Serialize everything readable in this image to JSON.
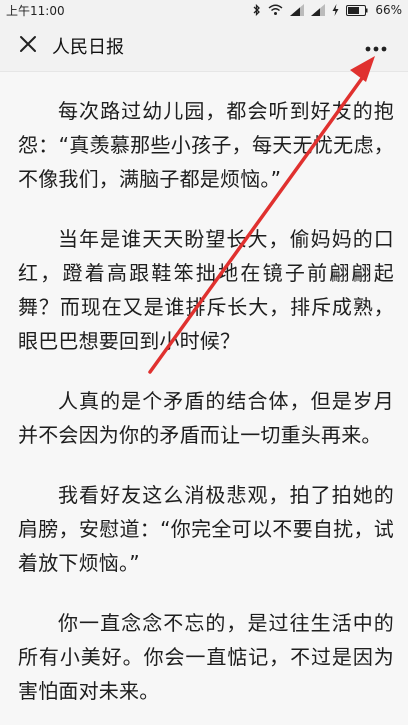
{
  "status_bar": {
    "time": "上午11:00",
    "battery": "66%",
    "icons": [
      "bluetooth-icon",
      "wifi-icon",
      "signal-icon",
      "signal-icon",
      "charging-icon",
      "battery-icon"
    ]
  },
  "nav": {
    "title": "人民日报",
    "close_icon": "close-icon",
    "more_icon": "more-dots-icon"
  },
  "article": {
    "paragraphs": [
      "每次路过幼儿园，都会听到好友的抱怨：“真羡慕那些小孩子，每天无忧无虑，不像我们，满脑子都是烦恼。”",
      "当年是谁天天盼望长大，偷妈妈的口红，蹬着高跟鞋笨拙地在镜子前翩翩起舞？而现在又是谁排斥长大，排斥成熟，眼巴巴想要回到小时候？",
      "人真的是个矛盾的结合体，但是岁月并不会因为你的矛盾而让一切重头再来。",
      "我看好友这么消极悲观，拍了拍她的肩膀，安慰道：“你完全可以不要自扰，试着放下烦恼。”",
      "你一直念念不忘的，是过往生活中的所有小美好。你会一直惦记，不过是因为害怕面对未来。"
    ]
  },
  "annotation": {
    "arrow_color": "#e0312f"
  }
}
